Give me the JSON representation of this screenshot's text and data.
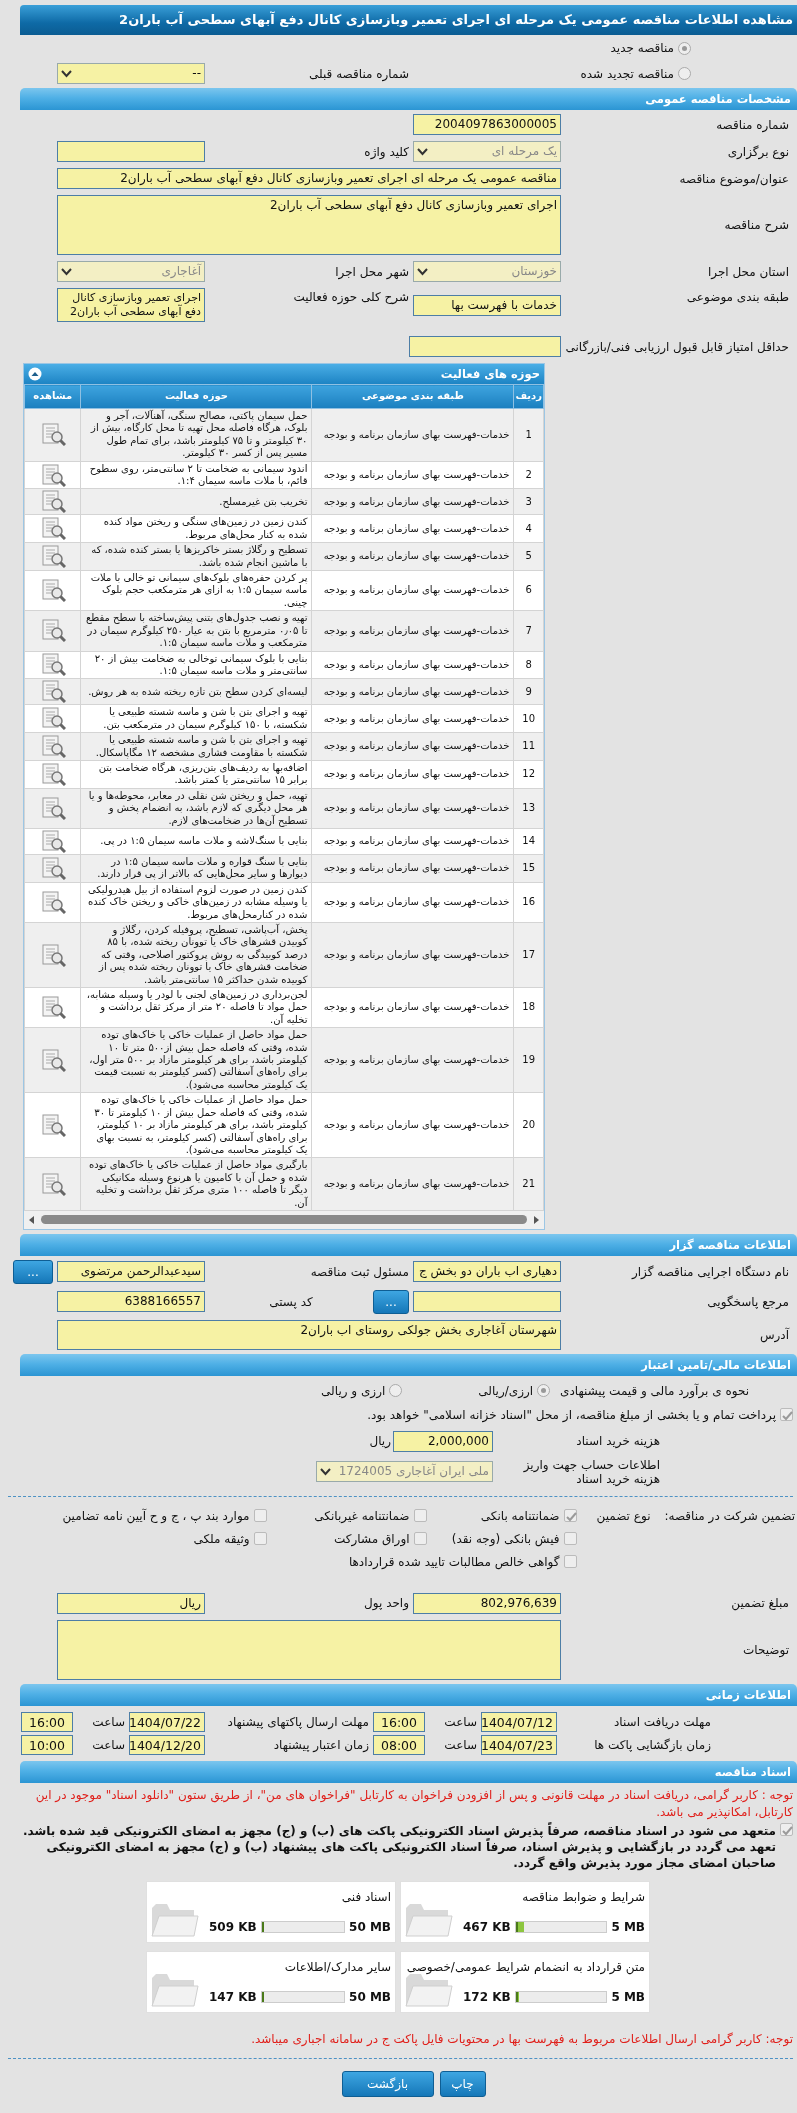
{
  "title": "مشاهده اطلاعات مناقصه عمومی یک مرحله ای اجرای تعمیر وبازسازی کانال دفع آبهای سطحی آب باران2",
  "tender_type": [
    {
      "label": "مناقصه جدید",
      "selected": true
    },
    {
      "label": "مناقصه تجدید شده",
      "selected": false
    }
  ],
  "previous_number": {
    "label": "شماره مناقصه قبلی",
    "value": "--",
    "kind": "select"
  },
  "general": {
    "header": "مشخصات مناقصه عمومی",
    "tender_number": {
      "label": "شماره مناقصه",
      "value": "2004097863000005",
      "kind": "input"
    },
    "procedure": {
      "label": "نوع برگزاری",
      "value": "یک مرحله ای",
      "kind": "select",
      "disabled": true
    },
    "keyword": {
      "label": "کلید واژه",
      "kind": "input"
    },
    "subject": {
      "label": "عنوان/موضوع مناقصه",
      "value": "مناقصه عمومی یک مرحله ای اجرای تعمیر وبازسازی کانال دفع آبهای سطحی آب باران2",
      "kind": "input"
    },
    "description": {
      "label": "شرح مناقصه",
      "value": "اجرای تعمیر وبازسازی کانال دفع آبهای سطحی آب باران2",
      "kind": "textarea"
    },
    "province": {
      "label": "استان محل اجرا",
      "value": "خوزستان",
      "kind": "select",
      "disabled": true
    },
    "city": {
      "label": "شهر محل اجرا",
      "value": "آغاجاری",
      "kind": "select",
      "disabled": true
    },
    "category": {
      "label": "طبقه بندی موضوعی",
      "value": "خدمات با فهرست بها",
      "kind": "input"
    },
    "scope": {
      "label": "شرح کلی حوزه فعالیت",
      "value": "اجرای تعمیر وبازسازی کانال دفع آبهای سطحی آب باران2",
      "kind": "textarea"
    },
    "min_score": {
      "label": "حداقل امتیاز قابل قبول ارزیابی فنی/بازرگانی",
      "kind": "input"
    }
  },
  "activities": {
    "header": "حوزه های فعالیت",
    "expanded": true,
    "columns": [
      "ردیف",
      "طبقه بندی موضوعی",
      "حوزه فعالیت",
      "مشاهده"
    ],
    "rows": [
      {
        "index": "1",
        "category": "خدمات-فهرست بهای سازمان برنامه و بودجه",
        "activity": "حمل سیمان پاکتی، مصالح سنگی، آهنآلات، آجر و بلوک، هرگاه فاصله محل تهیه تا محل کارگاه، بیش از ۳۰ کیلومتر و تا ۷۵ کیلومتر باشد، برای تمام طول مسیر پس از کسر ۳۰ کیلومتر."
      },
      {
        "index": "2",
        "category": "خدمات-فهرست بهای سازمان برنامه و بودجه",
        "activity": "اندود سیمانی به ضخامت تا ۲ سانتی‌متر، روی سطوح قائم، با ملات ماسه سیمان ۱:۴."
      },
      {
        "index": "3",
        "category": "خدمات-فهرست بهای سازمان برنامه و بودجه",
        "activity": "تخریب بتن غیرمسلح."
      },
      {
        "index": "4",
        "category": "خدمات-فهرست بهای سازمان برنامه و بودجه",
        "activity": "کندن زمین در زمین‌های سنگی و ریختن مواد کنده شده به کنار محل‌های مربوط."
      },
      {
        "index": "5",
        "category": "خدمات-فهرست بهای سازمان برنامه و بودجه",
        "activity": "تسطیح و رگلاژ بستر خاکریزها یا بستر کنده شده، که با ماشین انجام شده باشد."
      },
      {
        "index": "6",
        "category": "خدمات-فهرست بهای سازمان برنامه و بودجه",
        "activity": "پر کردن حفره‌های بلوک‌های سیمانی تو خالی با ملات ماسه سیمان ۱:۵ به ازای هر مترمکعب حجم بلوک چینی."
      },
      {
        "index": "7",
        "category": "خدمات-فهرست بهای سازمان برنامه و بودجه",
        "activity": "تهیه و نصب جدول‌های بتنی پیش‌ساخته با سطح مقطع تا ۰٫۰۵ مترمربع با بتن به عیار ۲۵۰ کیلوگرم سیمان در مترمکعب و ملات ماسه سیمان ۱:۵."
      },
      {
        "index": "8",
        "category": "خدمات-فهرست بهای سازمان برنامه و بودجه",
        "activity": "بنایی با بلوک سیمانی توخالی به ضخامت بیش از ۲۰ سانتی‌متر و ملات ماسه سیمان ۱:۵."
      },
      {
        "index": "9",
        "category": "خدمات-فهرست بهای سازمان برنامه و بودجه",
        "activity": "لیسه‌ای کردن سطح بتن تازه ریخته شده به هر روش."
      },
      {
        "index": "10",
        "category": "خدمات-فهرست بهای سازمان برنامه و بودجه",
        "activity": "تهیه و اجرای بتن با شن و ماسه شسته طبیعی یا شکسته، با ۱۵۰ کیلوگرم سیمان در مترمکعب بتن."
      },
      {
        "index": "11",
        "category": "خدمات-فهرست بهای سازمان برنامه و بودجه",
        "activity": "تهیه و اجرای بتن با شن و ماسه شسته طبیعی یا شکسته با مقاومت فشاری مشخصه ۱۲ مگاپاسکال."
      },
      {
        "index": "12",
        "category": "خدمات-فهرست بهای سازمان برنامه و بودجه",
        "activity": "اضافه‌بها به ردیف‌های بتن‌ریزی، هرگاه ضخامت بتن برابر ۱۵ سانتی‌متر یا کمتر باشد."
      },
      {
        "index": "13",
        "category": "خدمات-فهرست بهای سازمان برنامه و بودجه",
        "activity": "تهیه، حمل و ریختن شن نقلی در معابر، محوطه‌ها و یا هر محل دیگری که لازم باشد، به انضمام پخش و تسطیح آن‌ها در ضخامت‌های لازم."
      },
      {
        "index": "14",
        "category": "خدمات-فهرست بهای سازمان برنامه و بودجه",
        "activity": "بنایی با سنگ‌لاشه و ملات ماسه سیمان ۱:۵ در پی."
      },
      {
        "index": "15",
        "category": "خدمات-فهرست بهای سازمان برنامه و بودجه",
        "activity": "بنایی با سنگ قواره و ملات ماسه سیمان ۱:۵ در دیوارها و سایر محل‌هایی که بالاتر از پی قرار دارند."
      },
      {
        "index": "16",
        "category": "خدمات-فهرست بهای سازمان برنامه و بودجه",
        "activity": "کندن زمین در صورت لزوم استفاده از بیل هیدرولیکی یا وسیله مشابه در زمین‌های خاکی و ریختن خاک کنده شده در کنارمحل‌های مربوط."
      },
      {
        "index": "17",
        "category": "خدمات-فهرست بهای سازمان برنامه و بودجه",
        "activity": "پخش، آب‌پاشی، تسطیح، پروفیله کردن، رگلاژ و کوبیدن قشرهای خاک یا توونان ریخته شده، با ۸۵ درصد کوبیدگی به روش پروکتور اصلاحی، وقتی که ضخامت قشرهای خاک یا توونان ریخته شده پس از کوبیده شدن حداکثر ۱۵ سانتی‌متر باشد."
      },
      {
        "index": "18",
        "category": "خدمات-فهرست بهای سازمان برنامه و بودجه",
        "activity": "لجن‌برداری در زمین‌های لجنی با لودر یا وسیله مشابه، حمل مواد تا فاصله ۲۰ متر از مرکز ثقل برداشت و تخلیه آن."
      },
      {
        "index": "19",
        "category": "خدمات-فهرست بهای سازمان برنامه و بودجه",
        "activity": "حمل مواد حاصل از عملیات خاکی یا خاک‌های توده شده، وقتی که فاصله حمل بیش از۵۰۰ متر تا ۱۰ کیلومتر باشد، برای هر کیلومتر مازاد بر ۵۰۰ متر اول، برای راه‌های آسفالتی (کسر کیلومتر به نسبت قیمت یک کیلومتر محاسبه می‌شود)."
      },
      {
        "index": "20",
        "category": "خدمات-فهرست بهای سازمان برنامه و بودجه",
        "activity": "حمل مواد حاصل از عملیات خاکی یا خاک‌های توده شده، وقتی که فاصله حمل بیش از ۱۰ کیلومتر تا ۳۰ کیلومتر باشد، برای هر کیلومتر مازاد بر ۱۰ کیلومتر، برای راه‌های آسفالتی (کسر کیلومتر، به نسبت بهای یک کیلومتر محاسبه می‌شود)."
      },
      {
        "index": "21",
        "category": "خدمات-فهرست بهای سازمان برنامه و بودجه",
        "activity": "بارگیری مواد حاصل از عملیات خاکی یا خاک‌های توده شده و حمل آن با کامیون یا هرنوع وسیله مکانیکی دیگر تا فاصله ۱۰۰ متری مرکز ثقل برداشت و تخلیه آن."
      }
    ]
  },
  "organizer": {
    "header": "اطلاعات مناقصه گزار",
    "agency": {
      "label": "نام دستگاه اجرایی مناقصه گزار",
      "value": "دهیاری اب باران دو بخش ج",
      "kind": "input"
    },
    "registrar": {
      "label": "مسئول ثبت مناقصه",
      "value": "سیدعبدالرحمن مرتضوی",
      "kind": "input"
    },
    "registrar_button": "...",
    "reference": {
      "label": "مرجع پاسخگویی",
      "kind": "input"
    },
    "reference_button": "...",
    "postal_code": {
      "label": "کد پستی",
      "value": "6388166557",
      "kind": "input"
    },
    "address": {
      "label": "آدرس",
      "value": "شهرستان آغاجاری بخش جولکی روستای اب باران2",
      "kind": "textarea"
    }
  },
  "finance": {
    "header": "اطلاعات مالی/تامین اعتبار",
    "estimate_label": "نحوه ی برآورد مالی و قیمت پیشنهادی",
    "estimate_options": [
      {
        "label": "ارزی/ریالی",
        "selected": true
      },
      {
        "label": "ارزی و ریالی",
        "selected": false
      }
    ],
    "treasury": {
      "label": "پرداخت تمام و یا بخشی از مبلغ مناقصه، از محل \"اسناد خزانه اسلامی\" خواهد بود.",
      "checked": true
    },
    "document_fee": {
      "label": "هزینه خرید اسناد",
      "value": "2,000,000",
      "kind": "input"
    },
    "fee_unit": "ریال",
    "account": {
      "label": "اطلاعات حساب جهت واریز هزینه خرید اسناد",
      "value": "ملی ایران آغاجاری 1724005",
      "kind": "select",
      "disabled": true
    },
    "guarantee_label": "تضمین شرکت در مناقصه:",
    "guarantee_type_label": "نوع تضمین",
    "guarantee_types": [
      {
        "label": "ضمانتنامه بانکی",
        "checked": true
      },
      {
        "label": "ضمانتنامه غیربانکی",
        "checked": false
      },
      {
        "label": "موارد بند پ ، ج و ح آیین نامه تضامین",
        "checked": false
      },
      {
        "label": "فیش بانکی (وجه نقد)",
        "checked": false
      },
      {
        "label": "اوراق مشارکت",
        "checked": false
      },
      {
        "label": "وثیقه ملکی",
        "checked": false
      },
      {
        "label": "گواهی خالص مطالبات تایید شده قراردادها",
        "checked": false
      }
    ],
    "guarantee_amount": {
      "label": "مبلغ تضمین",
      "value": "802,976,639",
      "kind": "input"
    },
    "currency": {
      "label": "واحد پول",
      "value": "ریال",
      "kind": "input"
    },
    "notes": {
      "label": "توضیحات",
      "kind": "textarea"
    }
  },
  "timing": {
    "header": "اطلاعات زمانی",
    "items": [
      {
        "label": "مهلت دریافت اسناد",
        "date": "1404/07/12",
        "time_label": "ساعت",
        "time": "16:00"
      },
      {
        "label": "مهلت ارسال پاکتهای پیشنهاد",
        "date": "1404/07/22",
        "time_label": "ساعت",
        "time": "16:00"
      },
      {
        "label": "زمان بازگشایی پاکت ها",
        "date": "1404/07/23",
        "time_label": "ساعت",
        "time": "08:00"
      },
      {
        "label": "زمان اعتبار پیشنهاد",
        "date": "1404/12/20",
        "time_label": "ساعت",
        "time": "10:00"
      }
    ]
  },
  "documents": {
    "header": "اسناد مناقصه",
    "notice": "توجه : کاربر گرامی، دریافت اسناد در مهلت قانونی و پس از افزودن فراخوان به کارتابل \"فراخوان های من\"، از طریق ستون \"دانلود اسناد\" موجود در این کارتابل، امکانپذیر می باشد.",
    "commitment": {
      "label": "متعهد می شود در اسناد مناقصه، صرفاً پذیرش اسناد الکترونیکی پاکت های (ب) و (ج) مجهز به امضای الکترونیکی قید شده باشد. تعهد می گردد در بازگشایی و پذیرش اسناد، صرفاً اسناد الکترونیکی پاکت های پیشنهاد (ب) و (ج) مجهز به امضای الکترونیکی صاحبان امضای مجاز مورد پذیرش واقع گردد.",
      "checked": true
    },
    "files": [
      {
        "title": "شرایط و ضوابط مناقصه",
        "max": "5 MB",
        "size": "467 KB",
        "level": 0.09
      },
      {
        "title": "اسناد فنی",
        "max": "50 MB",
        "size": "509 KB",
        "level": 0.01
      },
      {
        "title": "متن قرارداد به انضمام شرایط عمومی/خصوصی",
        "max": "5 MB",
        "size": "172 KB",
        "level": 0.034
      },
      {
        "title": "سایر مدارک/اطلاعات",
        "max": "50 MB",
        "size": "147 KB",
        "level": 0.003
      }
    ],
    "note": "توجه: کاربر گرامی ارسال اطلاعات مربوط به فهرست بها در محتویات فایل پاکت ج در سامانه اجباری میباشد."
  },
  "buttons": [
    "چاپ",
    "بازگشت"
  ]
}
